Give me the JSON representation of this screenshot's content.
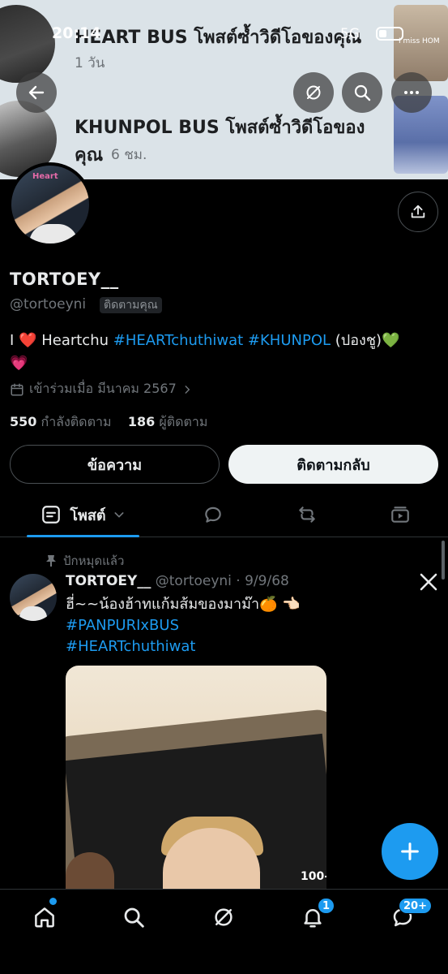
{
  "status_bar": {
    "time": "20:14",
    "network": "5G"
  },
  "notifications": [
    {
      "text": "HEART BUS โพสต์ซ้ำวิดีโอของคุณ",
      "time": "1 วัน",
      "thumb_caption": "I miss HOM"
    },
    {
      "text": "KHUNPOL BUS โพสต์ซ้ำวิดีโอของ",
      "text_line2": "คุณ",
      "time": "6 ชม."
    }
  ],
  "profile": {
    "avatar_caption": "Heart",
    "name": "TORTOEY__",
    "handle": "@tortoeyni",
    "follows_you": "ติดตามคุณ",
    "bio": {
      "prefix": "I",
      "heart1": "❤️",
      "word": "Heartchu",
      "tag1": "#HEARTchuthiwat",
      "tag2": "#KHUNPOL",
      "suffix": "(ปองชู)",
      "heart2": "💚",
      "heart3": "💗"
    },
    "joined": "เข้าร่วมเมื่อ มีนาคม 2567",
    "following_count": "550",
    "following_label": "กำลังติดตาม",
    "followers_count": "186",
    "followers_label": "ผู้ติดตาม",
    "message_button": "ข้อความ",
    "follow_back_button": "ติดตามกลับ"
  },
  "tabs": {
    "posts_label": "โพสต์"
  },
  "post": {
    "pinned_label": "ปักหมุดแล้ว",
    "author_name": "TORTOEY__",
    "author_meta": "@tortoeyni · 9/9/68",
    "text": "ฮี่~~น้องฮ้าทแก้มส้มของมาม๊า🍊 👈🏻",
    "hashtag1": "#PANPURIxBUS",
    "hashtag2": "#HEARTchuthiwat",
    "media_caption": "100-"
  },
  "bottom_nav": {
    "notifications_badge": "1",
    "messages_badge": "20+"
  },
  "colors": {
    "accent": "#1d9bf0",
    "background": "#000000",
    "muted": "#71767b"
  }
}
